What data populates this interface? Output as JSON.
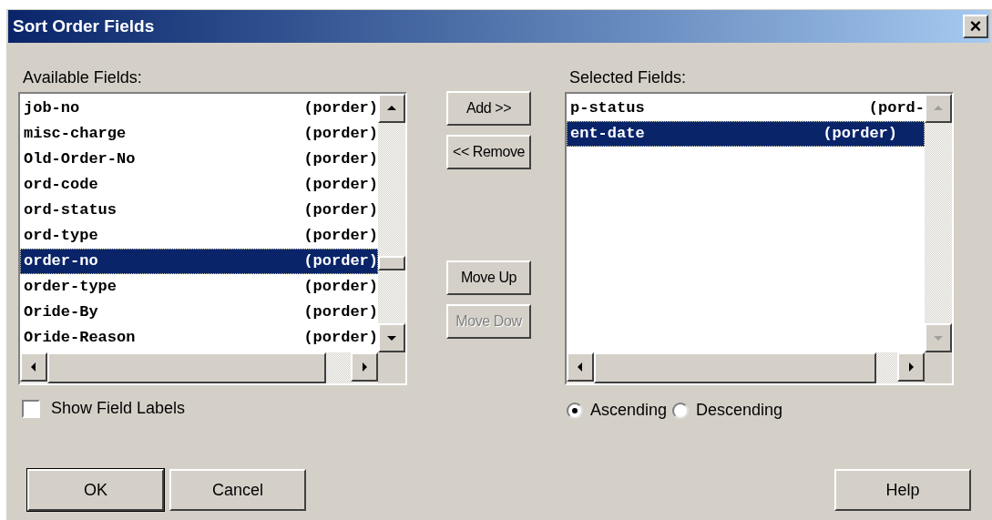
{
  "window": {
    "title": "Sort Order Fields",
    "close": "×"
  },
  "available": {
    "label": "Available Fields:",
    "items": [
      {
        "name": "job-no",
        "source": "(porder)",
        "selected": false
      },
      {
        "name": "misc-charge",
        "source": "(porder)",
        "selected": false
      },
      {
        "name": "Old-Order-No",
        "source": "(porder)",
        "selected": false
      },
      {
        "name": "ord-code",
        "source": "(porder)",
        "selected": false
      },
      {
        "name": "ord-status",
        "source": "(porder)",
        "selected": false
      },
      {
        "name": "ord-type",
        "source": "(porder)",
        "selected": false
      },
      {
        "name": "order-no",
        "source": "(porder)",
        "selected": true
      },
      {
        "name": "order-type",
        "source": "(porder)",
        "selected": false
      },
      {
        "name": "Oride-By",
        "source": "(porder)",
        "selected": false
      },
      {
        "name": "Oride-Reason",
        "source": "(porder)",
        "selected": false
      }
    ]
  },
  "middle_buttons": [
    {
      "label": "Add >>",
      "disabled": false
    },
    {
      "label": "<< Remove",
      "disabled": false
    },
    {
      "label": "Move Up",
      "disabled": false
    },
    {
      "label": "Move Dow",
      "disabled": true
    }
  ],
  "selected_fields": {
    "label": "Selected Fields:",
    "items": [
      {
        "name": "p-status",
        "source": "(pord-",
        "selected": false
      },
      {
        "name": "ent-date",
        "source": "(porder)",
        "selected": true
      }
    ]
  },
  "show_labels": {
    "label": "Show Field Labels",
    "checked": false
  },
  "order": [
    {
      "label": "Ascending",
      "selected": true
    },
    {
      "label": "Descending",
      "selected": false
    }
  ],
  "footer": [
    {
      "label": "OK",
      "default": true
    },
    {
      "label": "Cancel",
      "default": false
    },
    {
      "label": "Help",
      "default": false
    }
  ]
}
